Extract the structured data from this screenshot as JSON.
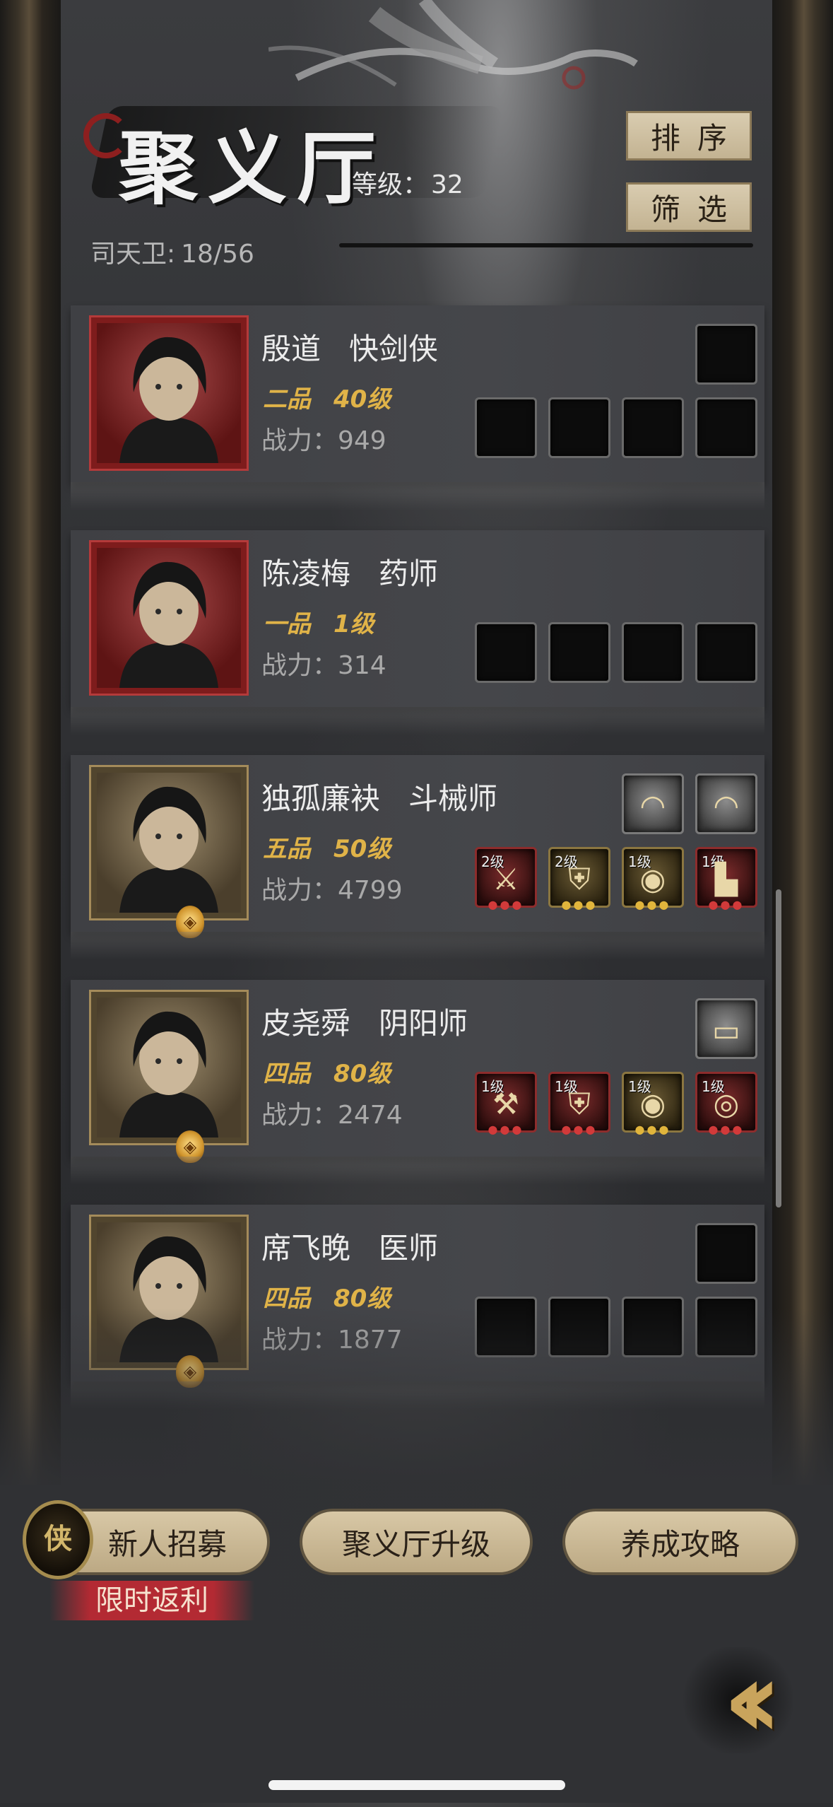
{
  "header": {
    "title": "聚义厅",
    "level_label": "等级：",
    "level_value": "32",
    "member_label": "司天卫:",
    "member_count": "18/56",
    "sort_button": "排序",
    "filter_button": "筛选"
  },
  "heroes": [
    {
      "name": "殷道",
      "role": "快剑侠",
      "grade": "二品",
      "level": "40级",
      "power_label": "战力：",
      "power": "949",
      "frame": "red",
      "has_badge": false,
      "top_slots": [
        "empty"
      ],
      "equip_slots": [
        {
          "state": "empty"
        },
        {
          "state": "empty"
        },
        {
          "state": "empty"
        },
        {
          "state": "empty"
        }
      ]
    },
    {
      "name": "陈凌梅",
      "role": "药师",
      "grade": "一品",
      "level": "1级",
      "power_label": "战力：",
      "power": "314",
      "frame": "red",
      "has_badge": false,
      "top_slots": [],
      "equip_slots": [
        {
          "state": "empty"
        },
        {
          "state": "empty"
        },
        {
          "state": "empty"
        },
        {
          "state": "empty"
        }
      ]
    },
    {
      "name": "独孤廉袂",
      "role": "斗械师",
      "grade": "五品",
      "level": "50级",
      "power_label": "战力：",
      "power": "4799",
      "frame": "gold",
      "has_badge": true,
      "top_slots": [
        "comb-item",
        "comb-item"
      ],
      "equip_slots": [
        {
          "state": "item-red",
          "level": "2级",
          "icon": "crossbow-icon"
        },
        {
          "state": "item-gold",
          "level": "2级",
          "icon": "armor-icon"
        },
        {
          "state": "item-gold",
          "level": "1级",
          "icon": "coin-icon"
        },
        {
          "state": "item-red",
          "level": "1级",
          "icon": "boots-icon"
        }
      ]
    },
    {
      "name": "皮尧舜",
      "role": "阴阳师",
      "grade": "四品",
      "level": "80级",
      "power_label": "战力：",
      "power": "2474",
      "frame": "gold",
      "has_badge": true,
      "top_slots": [
        "scroll-item"
      ],
      "equip_slots": [
        {
          "state": "item-red",
          "level": "1级",
          "icon": "claw-icon"
        },
        {
          "state": "item-red",
          "level": "1级",
          "icon": "armor-icon"
        },
        {
          "state": "item-gold",
          "level": "1级",
          "icon": "coin-icon"
        },
        {
          "state": "item-red",
          "level": "1级",
          "icon": "amulet-icon"
        }
      ]
    },
    {
      "name": "席飞晚",
      "role": "医师",
      "grade": "四品",
      "level": "80级",
      "power_label": "战力：",
      "power": "1877",
      "frame": "gold",
      "has_badge": true,
      "top_slots": [
        "empty"
      ],
      "equip_slots": [
        {
          "state": "empty"
        },
        {
          "state": "empty"
        },
        {
          "state": "empty"
        },
        {
          "state": "empty"
        }
      ]
    }
  ],
  "footer": {
    "recruit_button": "新人招募",
    "recruit_token": "侠",
    "promo_tag": "限时返利",
    "upgrade_button": "聚义厅升级",
    "guide_button": "养成攻略",
    "back_icon": "double-chevron-left-icon"
  }
}
